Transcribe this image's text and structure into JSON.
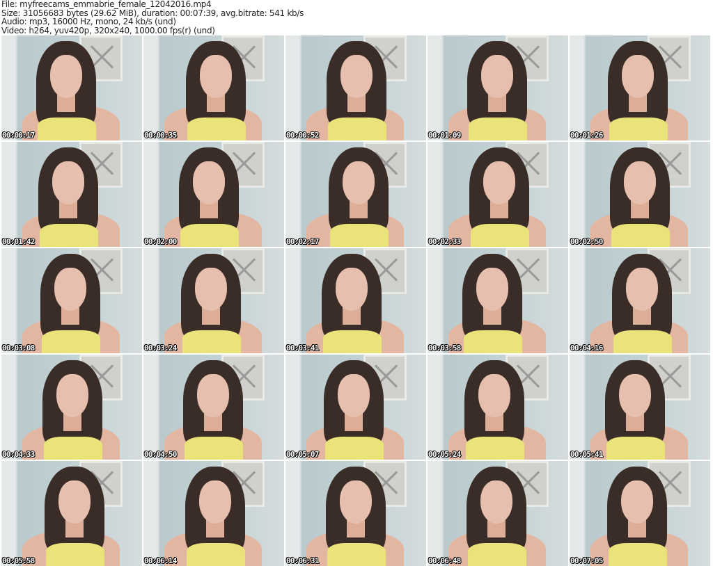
{
  "info": {
    "file": "File: myfreecams_emmabrie_female_12042016.mp4",
    "size": "Size: 31056683 bytes (29.62 MiB), duration: 00:07:39, avg.bitrate: 541 kb/s",
    "audio": "Audio: mp3, 16000 Hz, mono, 24 kb/s (und)",
    "video": "Video: h264, yuv420p, 320x240, 1000.00 fps(r) (und)"
  },
  "thumbnails": [
    "00:00:17",
    "00:00:35",
    "00:00:52",
    "00:01:09",
    "00:01:26",
    "00:01:42",
    "00:02:00",
    "00:02:17",
    "00:02:33",
    "00:02:50",
    "00:03:08",
    "00:03:24",
    "00:03:41",
    "00:03:58",
    "00:04:16",
    "00:04:33",
    "00:04:50",
    "00:05:07",
    "00:05:24",
    "00:05:41",
    "00:05:58",
    "00:06:14",
    "00:06:31",
    "00:06:48",
    "00:07:05"
  ]
}
